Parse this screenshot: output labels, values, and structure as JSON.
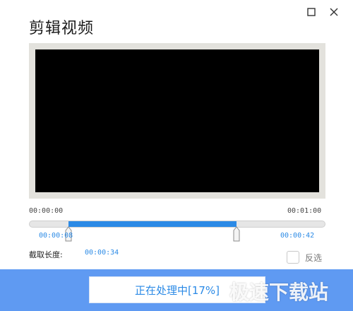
{
  "window": {
    "title": "剪辑视频"
  },
  "timeline": {
    "start_time": "00:00:00",
    "end_time": "00:01:00",
    "selection_start": "00:00:08",
    "selection_end": "00:00:42",
    "selection_start_fraction": 0.1333,
    "selection_end_fraction": 0.7
  },
  "clip": {
    "length_label": "截取长度:",
    "length_value": "00:00:34"
  },
  "options": {
    "reverse_label": "反选",
    "reverse_checked": false
  },
  "status": {
    "progress_text": "正在处理中[17%]",
    "progress_percent": 17
  },
  "watermark": {
    "text": "极速下载站"
  },
  "colors": {
    "accent": "#2b8ae6",
    "footer": "#5f9af2",
    "video_bg": "#000000",
    "frame": "#e3e2dd"
  },
  "icons": {
    "maximize": "maximize-icon",
    "close": "close-icon"
  }
}
